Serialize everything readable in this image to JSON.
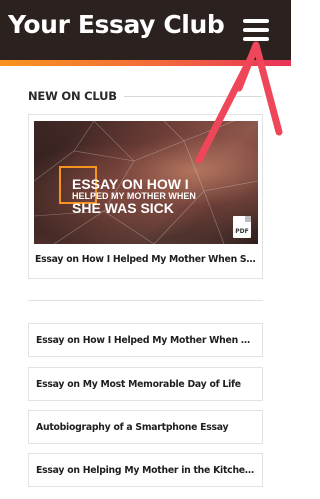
{
  "header": {
    "site_title": "Your Essay Club",
    "menu_icon": "hamburger-menu-icon"
  },
  "section": {
    "heading": "NEW ON CLUB"
  },
  "featured": {
    "image_text_line1": "ESSAY ON HOW I",
    "image_text_line2": "HELPED MY MOTHER WHEN",
    "image_text_line3": "SHE WAS SICK",
    "pdf_label": "PDF",
    "title": "Essay on How I Helped My Mother When She w..."
  },
  "list": [
    {
      "title": "Essay on How I Helped My Mother When She w..."
    },
    {
      "title": "Essay on My Most Memorable Day of Life"
    },
    {
      "title": "Autobiography of a Smartphone Essay"
    },
    {
      "title": "Essay on Helping My Mother in the Kitchen [P..."
    }
  ],
  "colors": {
    "header_bg": "#2b2220",
    "accent_start": "#f7941d",
    "accent_end": "#e8325a",
    "annotation_arrow": "#f0465a"
  }
}
